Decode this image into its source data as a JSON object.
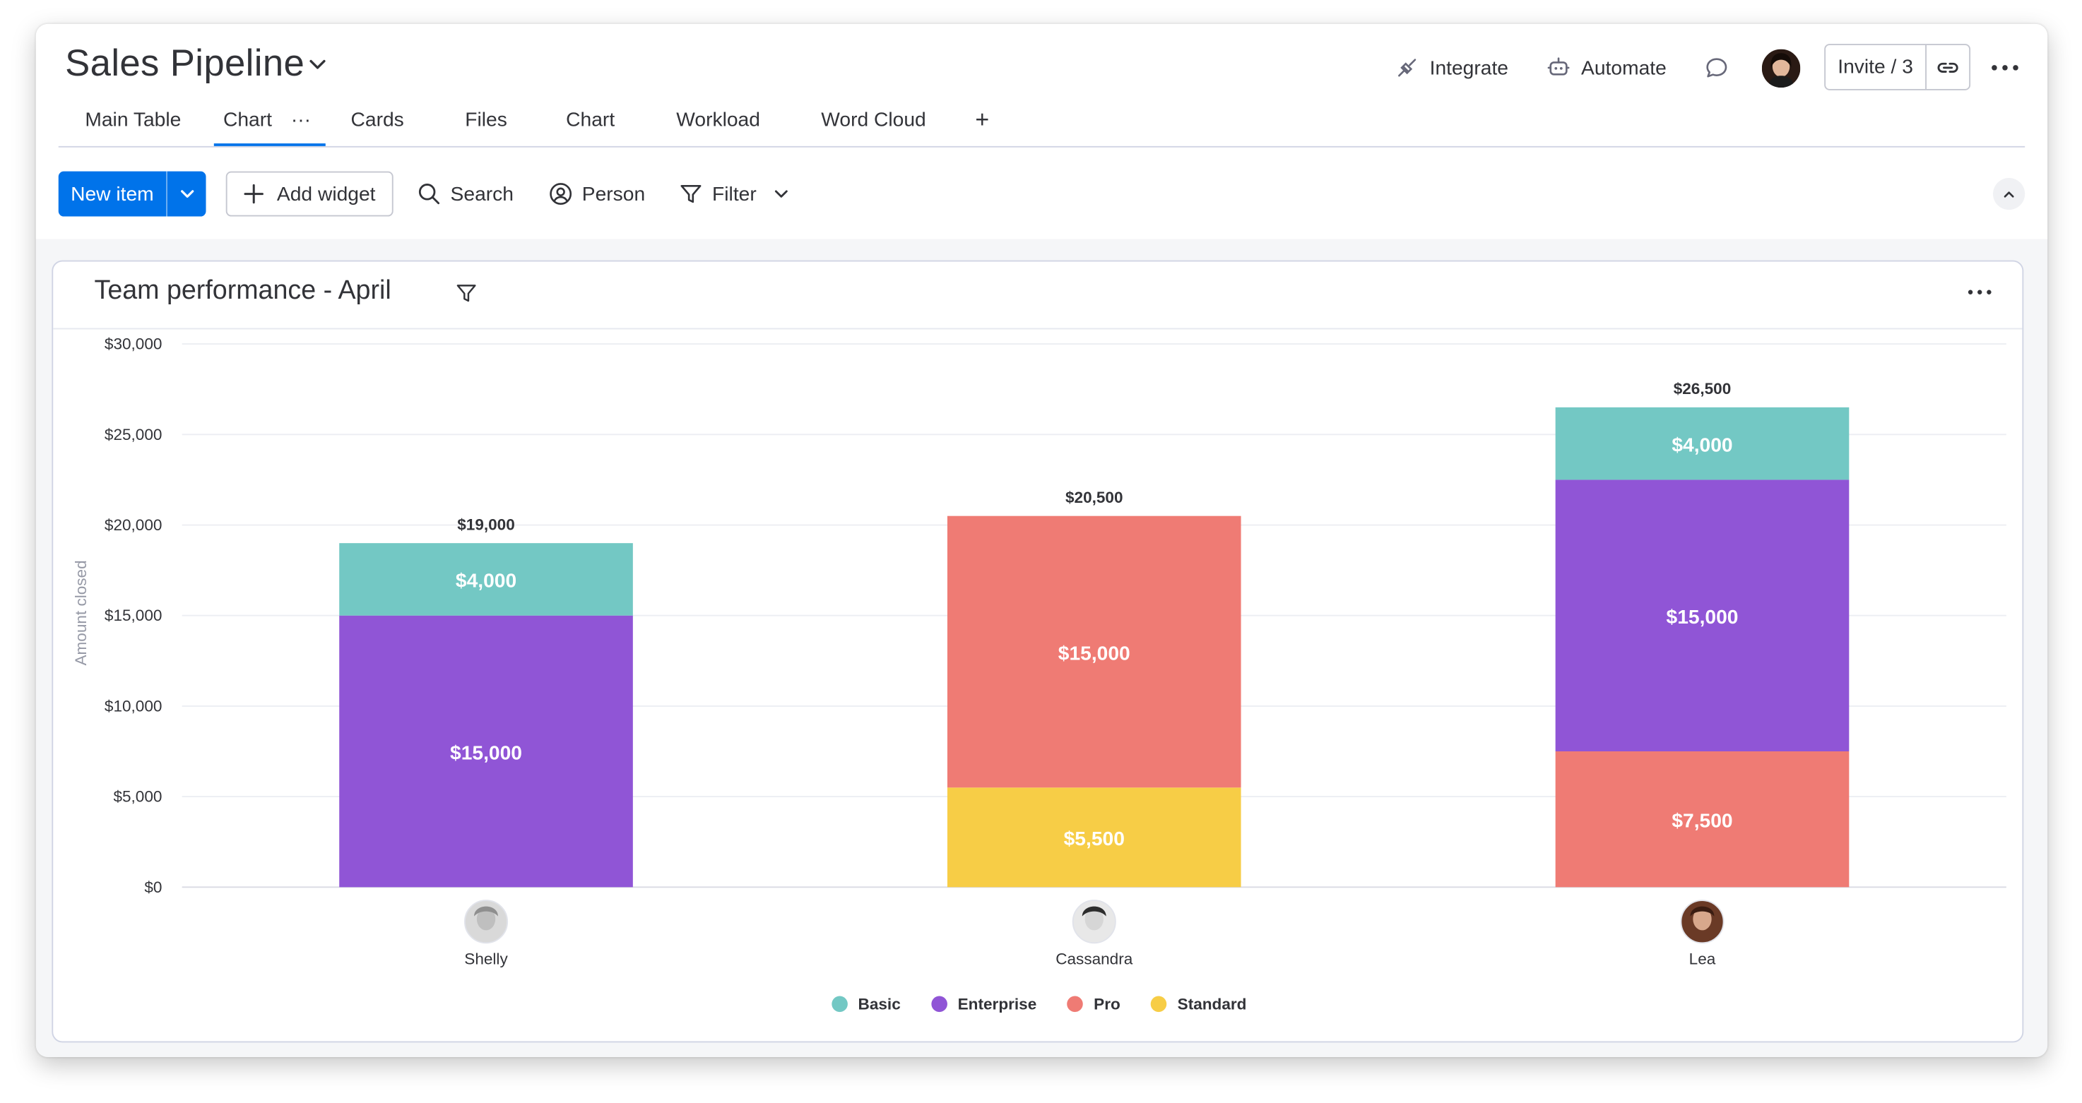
{
  "header": {
    "title": "Sales Pipeline",
    "integrate_label": "Integrate",
    "automate_label": "Automate",
    "invite_label": "Invite / 3"
  },
  "tabs": [
    {
      "label": "Main Table"
    },
    {
      "label": "Chart",
      "active": true
    },
    {
      "label": "Cards"
    },
    {
      "label": "Files"
    },
    {
      "label": "Chart"
    },
    {
      "label": "Workload"
    },
    {
      "label": "Word Cloud"
    }
  ],
  "toolbar": {
    "new_item_label": "New item",
    "add_widget_label": "Add widget",
    "search_label": "Search",
    "person_label": "Person",
    "filter_label": "Filter"
  },
  "widget": {
    "title": "Team performance - April"
  },
  "colors": {
    "accent": "#0073ea",
    "Basic": "#73c8c4",
    "Enterprise": "#9055d6",
    "Pro": "#ef7b74",
    "Standard": "#f7cd46"
  },
  "chart_data": {
    "type": "bar",
    "stacked": true,
    "categories": [
      "Shelly",
      "Cassandra",
      "Lea"
    ],
    "ylabel": "Amount closed",
    "ylim": [
      0,
      30000
    ],
    "yticks": [
      "$0",
      "$5,000",
      "$10,000",
      "$15,000",
      "$20,000",
      "$25,000",
      "$30,000"
    ],
    "grid": true,
    "legend_position": "bottom",
    "totals": [
      "$19,000",
      "$20,500",
      "$26,500"
    ],
    "series": [
      {
        "name": "Standard",
        "color": "#f7cd46",
        "values": [
          0,
          5500,
          0
        ],
        "labels": [
          "",
          "$5,500",
          ""
        ]
      },
      {
        "name": "Pro",
        "color": "#ef7b74",
        "values": [
          0,
          15000,
          7500
        ],
        "labels": [
          "",
          "$15,000",
          "$7,500"
        ]
      },
      {
        "name": "Enterprise",
        "color": "#9055d6",
        "values": [
          15000,
          0,
          15000
        ],
        "labels": [
          "$15,000",
          "",
          "$15,000"
        ]
      },
      {
        "name": "Basic",
        "color": "#73c8c4",
        "values": [
          4000,
          0,
          4000
        ],
        "labels": [
          "$4,000",
          "",
          "$4,000"
        ]
      }
    ]
  },
  "legend": [
    {
      "name": "Basic",
      "color": "#73c8c4"
    },
    {
      "name": "Enterprise",
      "color": "#9055d6"
    },
    {
      "name": "Pro",
      "color": "#ef7b74"
    },
    {
      "name": "Standard",
      "color": "#f7cd46"
    }
  ]
}
